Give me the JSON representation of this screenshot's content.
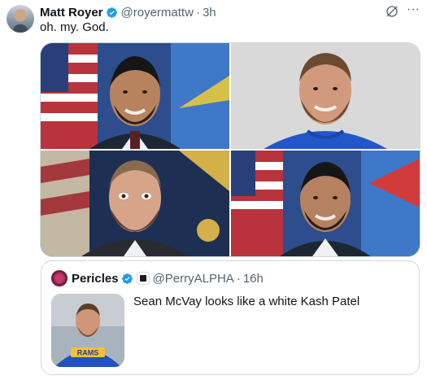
{
  "tweet": {
    "author_name": "Matt Royer",
    "handle": "@royermattw",
    "separator": "·",
    "time": "3h",
    "text": "oh. my. God.",
    "more_glyph": "···",
    "icons": {
      "verified": "verified-badge-icon",
      "grok": "grok-icon",
      "more": "more-icon"
    }
  },
  "media": {
    "photos": [
      {
        "label": "photo-1",
        "bg": "#2d4d8c",
        "face": "#b7835f",
        "shirt": "#1d2633"
      },
      {
        "label": "photo-2",
        "bg": "#d9d9d9",
        "face": "#d29a7c",
        "shirt": "#2356c9"
      },
      {
        "label": "photo-3",
        "bg": "#1e2f54",
        "face": "#d6a488",
        "shirt": "#2a2b30"
      },
      {
        "label": "photo-4",
        "bg": "#2d4d8c",
        "face": "#b58160",
        "shirt": "#1d2633"
      }
    ]
  },
  "quote": {
    "author_name": "Pericles",
    "handle": "@PerryALPHA",
    "separator": "·",
    "time": "16h",
    "text": "Sean McVay looks like a white Kash Patel",
    "thumb_caption": "RAMS"
  },
  "colors": {
    "accent": "#1d9bf0",
    "muted": "#536471",
    "border": "#cfd9de",
    "ink": "#0f1419"
  }
}
